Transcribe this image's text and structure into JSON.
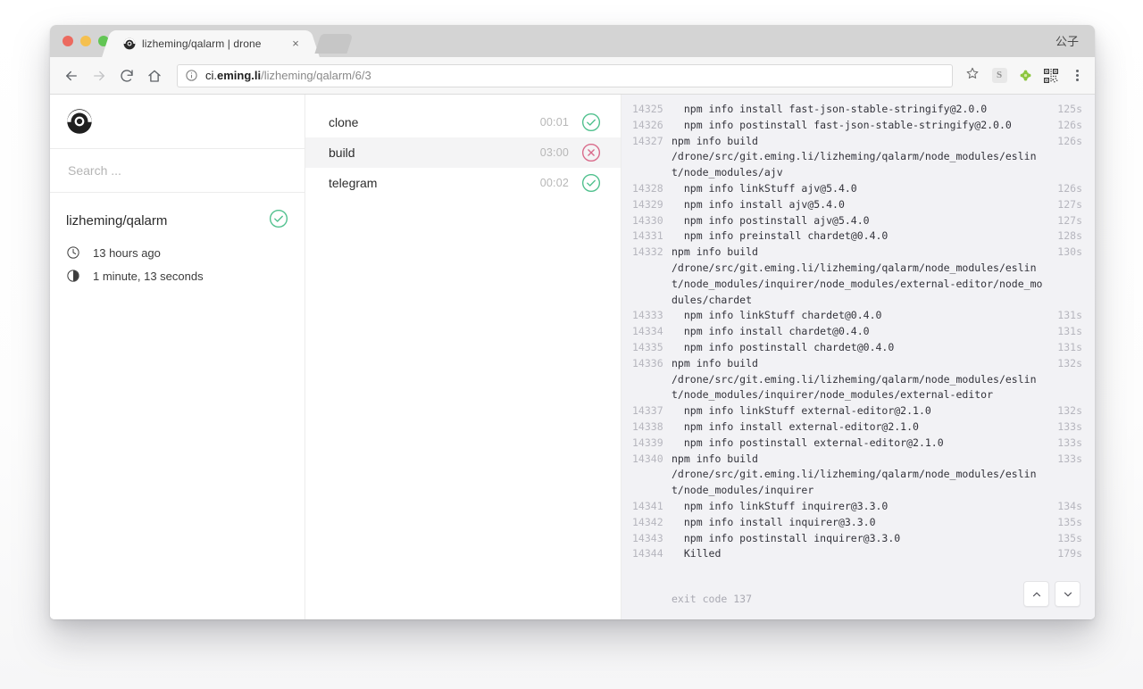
{
  "browser": {
    "tab": {
      "title": "lizheming/qalarm | drone",
      "favicon": "drone-icon",
      "close": "×"
    },
    "nav": {
      "back": "back-arrow-icon",
      "forward": "forward-arrow-icon",
      "reload": "reload-icon",
      "home": "home-icon"
    },
    "omnibox": {
      "info_icon": "info-circle-icon",
      "host_prefix": "ci.",
      "host_bold": "eming.li",
      "path": "/lizheming/qalarm/6/3",
      "star_icon": "star-icon"
    },
    "extensions": {
      "s_label": "S",
      "leaf": "leaf-icon",
      "qr": "qr-code-icon"
    },
    "menu": "kebab-menu-icon",
    "profile_name": "公子"
  },
  "sidebar": {
    "logo": "drone-logo",
    "search": {
      "placeholder": "Search ...",
      "value": ""
    },
    "repo": {
      "name": "lizheming/qalarm",
      "status": "success",
      "meta": [
        {
          "icon": "clock-icon",
          "text": "13 hours ago"
        },
        {
          "icon": "duration-icon",
          "text": "1 minute, 13 seconds"
        }
      ]
    }
  },
  "steps": [
    {
      "name": "clone",
      "time": "00:01",
      "status": "success"
    },
    {
      "name": "build",
      "time": "03:00",
      "status": "failure",
      "active": true
    },
    {
      "name": "telegram",
      "time": "00:02",
      "status": "success"
    }
  ],
  "console": {
    "lines": [
      {
        "n": "14325",
        "msg": "  npm info install fast-json-stable-stringify@2.0.0",
        "dur": "125s"
      },
      {
        "n": "14326",
        "msg": "  npm info postinstall fast-json-stable-stringify@2.0.0",
        "dur": "126s"
      },
      {
        "n": "14327",
        "msg": "npm info build\n/drone/src/git.eming.li/lizheming/qalarm/node_modules/eslint/node_modules/ajv",
        "dur": "126s"
      },
      {
        "n": "14328",
        "msg": "  npm info linkStuff ajv@5.4.0",
        "dur": "126s"
      },
      {
        "n": "14329",
        "msg": "  npm info install ajv@5.4.0",
        "dur": "127s"
      },
      {
        "n": "14330",
        "msg": "  npm info postinstall ajv@5.4.0",
        "dur": "127s"
      },
      {
        "n": "14331",
        "msg": "  npm info preinstall chardet@0.4.0",
        "dur": "128s"
      },
      {
        "n": "14332",
        "msg": "npm info build\n/drone/src/git.eming.li/lizheming/qalarm/node_modules/eslint/node_modules/inquirer/node_modules/external-editor/node_modules/chardet",
        "dur": "130s"
      },
      {
        "n": "14333",
        "msg": "  npm info linkStuff chardet@0.4.0",
        "dur": "131s"
      },
      {
        "n": "14334",
        "msg": "  npm info install chardet@0.4.0",
        "dur": "131s"
      },
      {
        "n": "14335",
        "msg": "  npm info postinstall chardet@0.4.0",
        "dur": "131s"
      },
      {
        "n": "14336",
        "msg": "npm info build\n/drone/src/git.eming.li/lizheming/qalarm/node_modules/eslint/node_modules/inquirer/node_modules/external-editor",
        "dur": "132s"
      },
      {
        "n": "14337",
        "msg": "  npm info linkStuff external-editor@2.1.0",
        "dur": "132s"
      },
      {
        "n": "14338",
        "msg": "  npm info install external-editor@2.1.0",
        "dur": "133s"
      },
      {
        "n": "14339",
        "msg": "  npm info postinstall external-editor@2.1.0",
        "dur": "133s"
      },
      {
        "n": "14340",
        "msg": "npm info build\n/drone/src/git.eming.li/lizheming/qalarm/node_modules/eslint/node_modules/inquirer",
        "dur": "133s"
      },
      {
        "n": "14341",
        "msg": "  npm info linkStuff inquirer@3.3.0",
        "dur": "134s"
      },
      {
        "n": "14342",
        "msg": "  npm info install inquirer@3.3.0",
        "dur": "135s"
      },
      {
        "n": "14343",
        "msg": "  npm info postinstall inquirer@3.3.0",
        "dur": "135s"
      },
      {
        "n": "14344",
        "msg": "  Killed",
        "dur": "179s"
      }
    ],
    "exit_code": "exit code 137",
    "scroll_up": "chevron-up-icon",
    "scroll_down": "chevron-down-icon"
  },
  "colors": {
    "success": "#4fc08d",
    "failure": "#d96a8a",
    "console_bg": "#f2f2f5",
    "line_number": "#b6b6be"
  }
}
